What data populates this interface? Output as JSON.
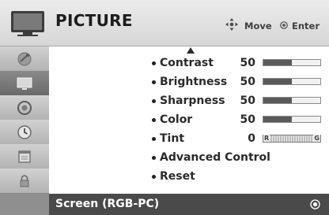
{
  "header": {
    "title": "PICTURE",
    "hint_move": "Move",
    "hint_enter": "Enter"
  },
  "sidebar": {
    "items": [
      {
        "icon": "satellite-dish-icon"
      },
      {
        "icon": "tv-picture-icon",
        "active": true
      },
      {
        "icon": "audio-icon"
      },
      {
        "icon": "clock-icon"
      },
      {
        "icon": "calendar-icon"
      },
      {
        "icon": "lock-icon"
      }
    ]
  },
  "menu": {
    "items": [
      {
        "label": "Contrast",
        "value": "50",
        "level": 0.5
      },
      {
        "label": "Brightness",
        "value": "50",
        "level": 0.5
      },
      {
        "label": "Sharpness",
        "value": "50",
        "level": 0.5
      },
      {
        "label": "Color",
        "value": "50",
        "level": 0.5
      },
      {
        "label": "Tint",
        "value": "0",
        "tint_left": "R",
        "tint_right": "G"
      },
      {
        "label": "Advanced Control"
      },
      {
        "label": "Reset"
      }
    ]
  },
  "footer": {
    "label": "Screen (RGB-PC)"
  }
}
